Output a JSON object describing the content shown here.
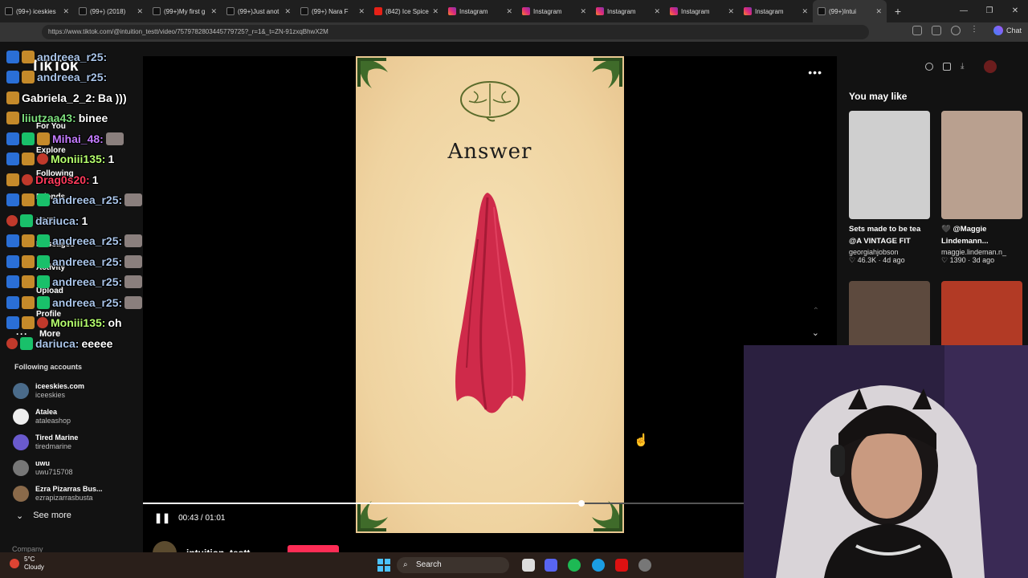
{
  "browser": {
    "tabs": [
      {
        "title": "(99+) iceskies",
        "favicon": "tiktok"
      },
      {
        "title": "(99+) (2018)",
        "favicon": "tiktok"
      },
      {
        "title": "(99+)My first g",
        "favicon": "tiktok"
      },
      {
        "title": "(99+)Just anot",
        "favicon": "tiktok"
      },
      {
        "title": "(99+) Nara F",
        "favicon": "tiktok"
      },
      {
        "title": "(842) Ice Spice",
        "favicon": "youtube"
      },
      {
        "title": "Instagram",
        "favicon": "instagram"
      },
      {
        "title": "Instagram",
        "favicon": "instagram"
      },
      {
        "title": "Instagram",
        "favicon": "instagram"
      },
      {
        "title": "Instagram",
        "favicon": "instagram"
      },
      {
        "title": "Instagram",
        "favicon": "instagram"
      },
      {
        "title": "(99+)Intui",
        "favicon": "tiktok",
        "active": true
      }
    ],
    "url": "https://www.tiktok.com/@intuition_testt/video/7579782803445779725?_r=1&_t=ZN-91zxqBhwX2M",
    "chat_button": "Chat"
  },
  "sidebar": {
    "logo": "TikTok",
    "nav": [
      "For You",
      "Explore",
      "Following",
      "Friends",
      "LIVE",
      "Messages",
      "Activity",
      "Upload",
      "Profile"
    ],
    "more": "More",
    "following_title": "Following accounts",
    "accounts": [
      {
        "name": "iceeskies.com",
        "handle": "iceeskies"
      },
      {
        "name": "Atalea",
        "handle": "ataleashop"
      },
      {
        "name": "Tired Marine",
        "handle": "tiredmarine"
      },
      {
        "name": "uwu",
        "handle": "uwu715708"
      },
      {
        "name": "Ezra Pizarras Bus...",
        "handle": "ezrapizarrasbusta"
      }
    ],
    "see_more": "See more",
    "company": "Company"
  },
  "chat": [
    {
      "user": "andreea_r25:",
      "msg": "",
      "color": "#a9c4e8",
      "badges": [
        "mod",
        "sub"
      ]
    },
    {
      "user": "andreea_r25:",
      "msg": "",
      "color": "#a9c4e8",
      "badges": [
        "mod",
        "sub"
      ]
    },
    {
      "user": "Gabriela_2_2:",
      "msg": "Ba )))",
      "color": "#ffffff",
      "badges": [
        "sub"
      ]
    },
    {
      "user": "liiutzaa43:",
      "msg": "binee",
      "color": "#7ee07e",
      "badges": [
        "sub"
      ]
    },
    {
      "user": "Mihai_48:",
      "msg": "",
      "color": "#c47cff",
      "badges": [
        "mod",
        "gift",
        "sub"
      ],
      "img": true
    },
    {
      "user": "Moniii135:",
      "msg": "1",
      "color": "#b6ff6e",
      "badges": [
        "mod",
        "sub",
        "heart"
      ]
    },
    {
      "user": "Drag0s20:",
      "msg": "1",
      "color": "#ff3b5c",
      "badges": [
        "sub",
        "heart"
      ]
    },
    {
      "user": "andreea_r25:",
      "msg": "",
      "color": "#a9c4e8",
      "badges": [
        "mod",
        "sub",
        "gift"
      ],
      "img": true
    },
    {
      "user": "dariuca:",
      "msg": "1",
      "color": "#a9c4e8",
      "badges": [
        "heart",
        "gift"
      ]
    },
    {
      "user": "andreea_r25:",
      "msg": "",
      "color": "#a9c4e8",
      "badges": [
        "mod",
        "sub",
        "gift"
      ],
      "img": true
    },
    {
      "user": "andreea_r25:",
      "msg": "",
      "color": "#a9c4e8",
      "badges": [
        "mod",
        "sub",
        "gift"
      ],
      "img": true
    },
    {
      "user": "andreea_r25:",
      "msg": "",
      "color": "#a9c4e8",
      "badges": [
        "mod",
        "sub",
        "gift"
      ],
      "img": true
    },
    {
      "user": "andreea_r25:",
      "msg": "",
      "color": "#a9c4e8",
      "badges": [
        "mod",
        "sub",
        "gift"
      ],
      "img": true
    },
    {
      "user": "Moniii135:",
      "msg": "oh",
      "color": "#b6ff6e",
      "badges": [
        "mod",
        "sub",
        "heart"
      ]
    },
    {
      "user": "dariuca:",
      "msg": "eeeee",
      "color": "#a9c4e8",
      "badges": [
        "heart",
        "gift"
      ]
    }
  ],
  "video": {
    "title": "Answer",
    "time": "00:43 / 01:01",
    "progress": 0.73,
    "author": "intuition_testt"
  },
  "recommendations": {
    "title": "You may like",
    "cards": [
      {
        "title": "Sets made to be tea @A VINTAGE FIT",
        "author": "georgiahjobson",
        "likes": "46.3K",
        "age": "4d ago",
        "thumb": "#cfcfcf"
      },
      {
        "title": "🖤 @Maggie Lindemann...",
        "author": "maggie.lindeman.n_",
        "likes": "1390",
        "age": "3d ago",
        "thumb": "#b9a08f"
      },
      {
        "title": "",
        "author": "",
        "likes": "",
        "age": "",
        "thumb": "#5d4a3e"
      },
      {
        "title": "",
        "author": "",
        "likes": "",
        "age": "",
        "thumb": "#b23a25"
      }
    ]
  },
  "taskbar": {
    "weather_temp": "5°C",
    "weather_desc": "Cloudy",
    "search": "Search"
  }
}
